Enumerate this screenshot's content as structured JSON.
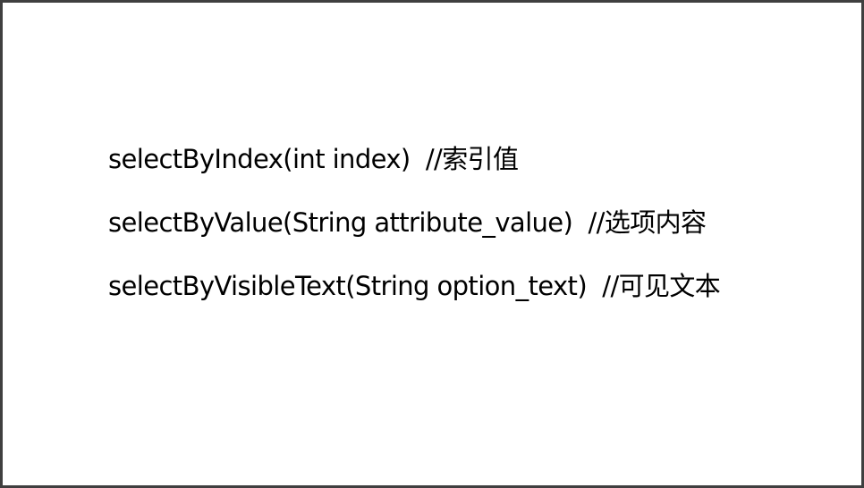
{
  "slide": {
    "lines": [
      "selectByIndex(int index)  //索引值",
      "selectByValue(String attribute_value)  //选项内容",
      "selectByVisibleText(String option_text)  //可见文本"
    ]
  }
}
